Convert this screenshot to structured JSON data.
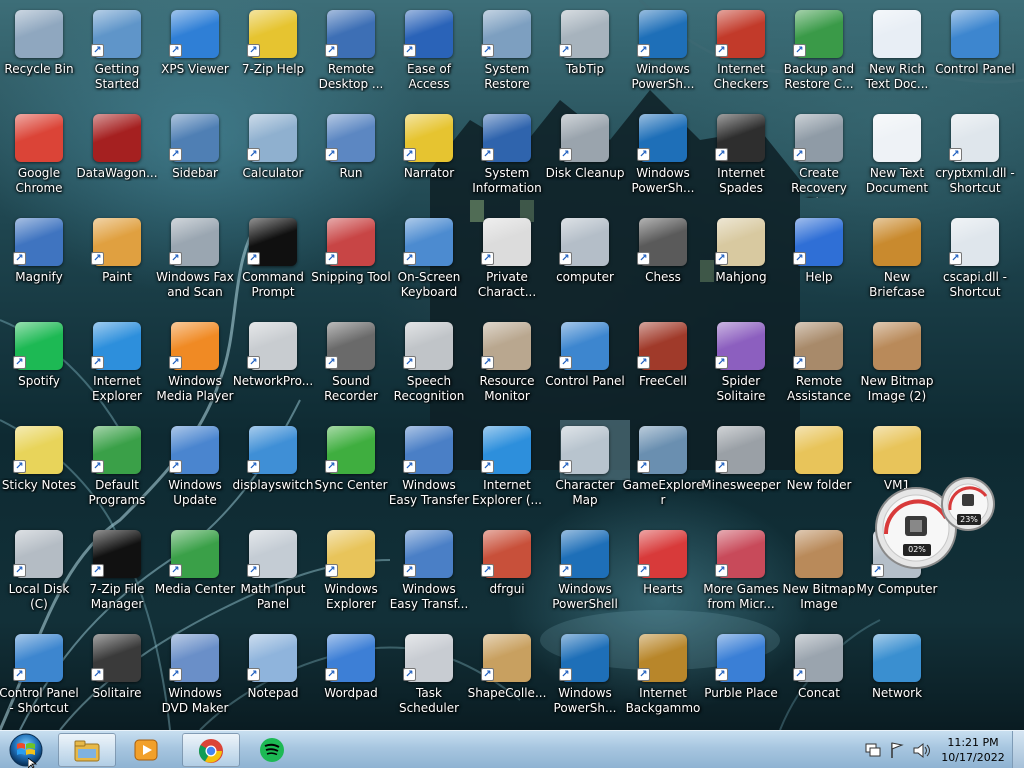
{
  "desktop": {
    "icons": [
      {
        "label": "Recycle Bin",
        "color": "#8fa7bf",
        "glyph": "recycle-bin-icon",
        "shortcut": false
      },
      {
        "label": "Getting Started",
        "color": "#5f95c9",
        "glyph": "getting-started-icon",
        "shortcut": true
      },
      {
        "label": "XPS Viewer",
        "color": "#2f7fd6",
        "glyph": "xps-viewer-icon",
        "shortcut": true
      },
      {
        "label": "7-Zip Help",
        "color": "#e6c430",
        "glyph": "help-question-icon",
        "shortcut": true
      },
      {
        "label": "Remote Desktop ...",
        "color": "#3d6fb5",
        "glyph": "remote-desktop-icon",
        "shortcut": true
      },
      {
        "label": "Ease of Access",
        "color": "#2a63b8",
        "glyph": "ease-of-access-icon",
        "shortcut": true
      },
      {
        "label": "System Restore",
        "color": "#7d9fc0",
        "glyph": "system-restore-icon",
        "shortcut": true
      },
      {
        "label": "TabTip",
        "color": "#a7b3bd",
        "glyph": "tabtip-icon",
        "shortcut": true
      },
      {
        "label": "Windows PowerSh...",
        "color": "#1e6fb8",
        "glyph": "powershell-icon",
        "shortcut": true
      },
      {
        "label": "Internet Checkers",
        "color": "#c23a2a",
        "glyph": "checkers-icon",
        "shortcut": true
      },
      {
        "label": "Backup and Restore C...",
        "color": "#3a9a48",
        "glyph": "backup-restore-icon",
        "shortcut": true
      },
      {
        "label": "New Rich Text Doc...",
        "color": "#e8eef5",
        "glyph": "rich-text-document-icon",
        "shortcut": false
      },
      {
        "label": "Control Panel",
        "color": "#3d86cf",
        "glyph": "control-panel-icon",
        "shortcut": false
      },
      {
        "label": "Google Chrome",
        "color": "#db4437",
        "glyph": "chrome-icon",
        "shortcut": false
      },
      {
        "label": "DataWagon...",
        "color": "#a52020",
        "glyph": "datawagon-icon",
        "shortcut": false
      },
      {
        "label": "Sidebar",
        "color": "#4f7fb4",
        "glyph": "sidebar-icon",
        "shortcut": true
      },
      {
        "label": "Calculator",
        "color": "#8fb0cf",
        "glyph": "calculator-icon",
        "shortcut": true
      },
      {
        "label": "Run",
        "color": "#5c87c2",
        "glyph": "run-icon",
        "shortcut": true
      },
      {
        "label": "Narrator",
        "color": "#e6c430",
        "glyph": "narrator-icon",
        "shortcut": true
      },
      {
        "label": "System Information",
        "color": "#2f64ad",
        "glyph": "system-information-icon",
        "shortcut": true
      },
      {
        "label": "Disk Cleanup",
        "color": "#9aa4ad",
        "glyph": "disk-cleanup-icon",
        "shortcut": true
      },
      {
        "label": "Windows PowerSh...",
        "color": "#1e6fb8",
        "glyph": "powershell-icon",
        "shortcut": true
      },
      {
        "label": "Internet Spades",
        "color": "#2e2e2e",
        "glyph": "spades-icon",
        "shortcut": true
      },
      {
        "label": "Create Recovery Disc",
        "color": "#8f9ba6",
        "glyph": "recovery-disc-icon",
        "shortcut": true
      },
      {
        "label": "New Text Document",
        "color": "#eef2f6",
        "glyph": "text-document-icon",
        "shortcut": false
      },
      {
        "label": "cryptxml.dll - Shortcut",
        "color": "#dfe6ec",
        "glyph": "dll-file-icon",
        "shortcut": true
      },
      {
        "label": "Magnify",
        "color": "#3f74c0",
        "glyph": "magnify-icon",
        "shortcut": true
      },
      {
        "label": "Paint",
        "color": "#e0a040",
        "glyph": "paint-icon",
        "shortcut": true
      },
      {
        "label": "Windows Fax and Scan",
        "color": "#9aa6b1",
        "glyph": "fax-scan-icon",
        "shortcut": true
      },
      {
        "label": "Command Prompt",
        "color": "#101010",
        "glyph": "command-prompt-icon",
        "shortcut": true
      },
      {
        "label": "Snipping Tool",
        "color": "#c84545",
        "glyph": "snipping-tool-icon",
        "shortcut": true
      },
      {
        "label": "On-Screen Keyboard",
        "color": "#4c8bd0",
        "glyph": "keyboard-icon",
        "shortcut": true
      },
      {
        "label": "Private Charact...",
        "color": "#dcdcdc",
        "glyph": "private-character-icon",
        "shortcut": true
      },
      {
        "label": "computer",
        "color": "#b4bec8",
        "glyph": "computer-icon",
        "shortcut": true
      },
      {
        "label": "Chess",
        "color": "#5a5a5a",
        "glyph": "chess-icon",
        "shortcut": true
      },
      {
        "label": "Mahjong",
        "color": "#d8c9a0",
        "glyph": "mahjong-icon",
        "shortcut": true
      },
      {
        "label": "Help",
        "color": "#2f6fd6",
        "glyph": "help-icon",
        "shortcut": true
      },
      {
        "label": "New Briefcase",
        "color": "#c98a2e",
        "glyph": "briefcase-icon",
        "shortcut": false
      },
      {
        "label": "cscapi.dll - Shortcut",
        "color": "#dfe6ec",
        "glyph": "dll-file-icon",
        "shortcut": true
      },
      {
        "label": "Spotify",
        "color": "#1db954",
        "glyph": "spotify-icon",
        "shortcut": true
      },
      {
        "label": "Internet Explorer",
        "color": "#2d8fdc",
        "glyph": "internet-explorer-icon",
        "shortcut": true
      },
      {
        "label": "Windows Media Player",
        "color": "#f08a24",
        "glyph": "media-player-icon",
        "shortcut": true
      },
      {
        "label": "NetworkPro...",
        "color": "#c8ccd0",
        "glyph": "projector-icon",
        "shortcut": true
      },
      {
        "label": "Sound Recorder",
        "color": "#6a6a6a",
        "glyph": "microphone-icon",
        "shortcut": true
      },
      {
        "label": "Speech Recognition",
        "color": "#c0c4c8",
        "glyph": "speech-microphone-icon",
        "shortcut": true
      },
      {
        "label": "Resource Monitor",
        "color": "#b9a78f",
        "glyph": "resource-monitor-icon",
        "shortcut": true
      },
      {
        "label": "Control Panel",
        "color": "#3d86cf",
        "glyph": "control-panel-icon",
        "shortcut": true
      },
      {
        "label": "FreeCell",
        "color": "#a03a2a",
        "glyph": "freecell-icon",
        "shortcut": true
      },
      {
        "label": "Spider Solitaire",
        "color": "#8c5fbf",
        "glyph": "spider-solitaire-icon",
        "shortcut": true
      },
      {
        "label": "Remote Assistance",
        "color": "#a88a6a",
        "glyph": "remote-assistance-icon",
        "shortcut": true
      },
      {
        "label": "New Bitmap Image (2)",
        "color": "#b98a5a",
        "glyph": "bitmap-image-icon",
        "shortcut": false
      },
      {
        "label": "Sticky Notes",
        "color": "#e8d45a",
        "glyph": "sticky-notes-icon",
        "shortcut": true
      },
      {
        "label": "Default Programs",
        "color": "#3aa048",
        "glyph": "default-programs-icon",
        "shortcut": true
      },
      {
        "label": "Windows Update",
        "color": "#4a85cf",
        "glyph": "windows-update-icon",
        "shortcut": true
      },
      {
        "label": "displayswitch",
        "color": "#3f8fd6",
        "glyph": "display-switch-icon",
        "shortcut": true
      },
      {
        "label": "Sync Center",
        "color": "#3fae3f",
        "glyph": "sync-center-icon",
        "shortcut": true
      },
      {
        "label": "Windows Easy Transfer",
        "color": "#4a7fc6",
        "glyph": "easy-transfer-icon",
        "shortcut": true
      },
      {
        "label": "Internet Explorer (...",
        "color": "#2d8fdc",
        "glyph": "internet-explorer-icon",
        "shortcut": true
      },
      {
        "label": "Character Map",
        "color": "#b8c4ce",
        "glyph": "character-map-icon",
        "shortcut": true
      },
      {
        "label": "GameExplorer",
        "color": "#6a8fb0",
        "glyph": "game-explorer-icon",
        "shortcut": true
      },
      {
        "label": "Minesweeper",
        "color": "#9aa0a6",
        "glyph": "minesweeper-icon",
        "shortcut": true
      },
      {
        "label": "New folder",
        "color": "#e8c45a",
        "glyph": "folder-icon",
        "shortcut": false
      },
      {
        "label": "VM1",
        "color": "#e8c45a",
        "glyph": "shared-folder-icon",
        "shortcut": false
      },
      {
        "label": "Local Disk (C)",
        "color": "#b4bcc4",
        "glyph": "local-disk-icon",
        "shortcut": true
      },
      {
        "label": "7-Zip File Manager",
        "color": "#111111",
        "glyph": "seven-zip-icon",
        "shortcut": true
      },
      {
        "label": "Media Center",
        "color": "#3aa048",
        "glyph": "media-center-icon",
        "shortcut": true
      },
      {
        "label": "Math Input Panel",
        "color": "#c4ccd4",
        "glyph": "math-input-icon",
        "shortcut": true
      },
      {
        "label": "Windows Explorer",
        "color": "#e8c45a",
        "glyph": "windows-explorer-icon",
        "shortcut": true
      },
      {
        "label": "Windows Easy Transf...",
        "color": "#4a7fc6",
        "glyph": "easy-transfer-icon",
        "shortcut": true
      },
      {
        "label": "dfrgui",
        "color": "#c8503a",
        "glyph": "defragmenter-icon",
        "shortcut": true
      },
      {
        "label": "Windows PowerShell",
        "color": "#1e6fb8",
        "glyph": "powershell-icon",
        "shortcut": true
      },
      {
        "label": "Hearts",
        "color": "#d83a3a",
        "glyph": "hearts-icon",
        "shortcut": true
      },
      {
        "label": "More Games from Micr...",
        "color": "#c84a5a",
        "glyph": "more-games-icon",
        "shortcut": true
      },
      {
        "label": "New Bitmap Image",
        "color": "#b98a5a",
        "glyph": "bitmap-image-icon",
        "shortcut": false
      },
      {
        "label": "My Computer",
        "color": "#b4bec8",
        "glyph": "my-computer-icon",
        "shortcut": true
      },
      {
        "label": "Control Panel - Shortcut",
        "color": "#3d86cf",
        "glyph": "control-panel-icon",
        "shortcut": true
      },
      {
        "label": "Solitaire",
        "color": "#3a3a3a",
        "glyph": "solitaire-icon",
        "shortcut": true
      },
      {
        "label": "Windows DVD Maker",
        "color": "#6a8fc8",
        "glyph": "dvd-maker-icon",
        "shortcut": true
      },
      {
        "label": "Notepad",
        "color": "#8fb4dc",
        "glyph": "notepad-icon",
        "shortcut": true
      },
      {
        "label": "Wordpad",
        "color": "#3d7fd6",
        "glyph": "wordpad-icon",
        "shortcut": true
      },
      {
        "label": "Task Scheduler",
        "color": "#c8ccd2",
        "glyph": "task-scheduler-icon",
        "shortcut": true
      },
      {
        "label": "ShapeColle...",
        "color": "#c8a060",
        "glyph": "shape-collector-icon",
        "shortcut": true
      },
      {
        "label": "Windows PowerSh...",
        "color": "#1e6fb8",
        "glyph": "powershell-icon",
        "shortcut": true
      },
      {
        "label": "Internet Backgammon",
        "color": "#b8862a",
        "glyph": "backgammon-icon",
        "shortcut": true
      },
      {
        "label": "Purble Place",
        "color": "#3a7fd6",
        "glyph": "purble-place-icon",
        "shortcut": true
      },
      {
        "label": "Concat",
        "color": "#9aa4ae",
        "glyph": "contact-icon",
        "shortcut": true
      },
      {
        "label": "Network",
        "color": "#3a8fd0",
        "glyph": "network-icon",
        "shortcut": false
      }
    ]
  },
  "gadget": {
    "cpu_label": "02%",
    "memory_label": "23%"
  },
  "taskbar": {
    "start_label": "Start",
    "pinned": [
      {
        "name": "file-explorer",
        "glyph": "folder-icon",
        "active": true
      },
      {
        "name": "media-player",
        "glyph": "media-player-icon",
        "active": false
      },
      {
        "name": "chrome",
        "glyph": "chrome-icon",
        "active": true
      },
      {
        "name": "spotify",
        "glyph": "spotify-icon",
        "active": false
      }
    ],
    "tray": {
      "network": "network-tray-icon",
      "action_center": "flag-icon",
      "volume": "speaker-icon"
    },
    "clock": {
      "time": "11:21 PM",
      "date": "10/17/2022"
    }
  }
}
